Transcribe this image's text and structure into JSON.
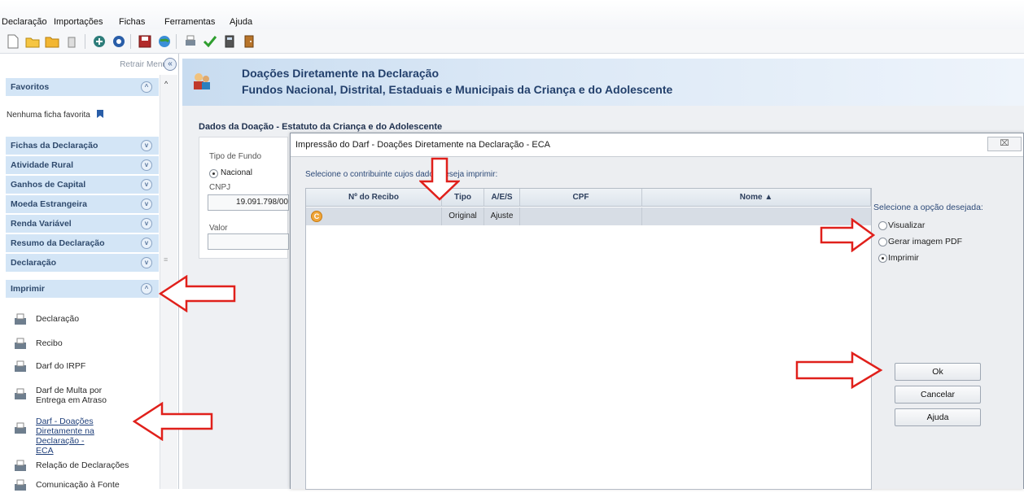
{
  "menu": {
    "items": [
      "Declaração",
      "Importações",
      "Fichas",
      "Ferramentas",
      "Ajuda"
    ]
  },
  "sidebar": {
    "retrair_label": "Retrair Menu",
    "favoritos_label": "Favoritos",
    "nenhuma_favorita": "Nenhuma ficha favorita",
    "sections": [
      "Fichas da Declaração",
      "Atividade Rural",
      "Ganhos de Capital",
      "Moeda Estrangeira",
      "Renda Variável",
      "Resumo da Declaração",
      "Declaração",
      "Imprimir"
    ],
    "print_items": [
      "Declaração",
      "Recibo",
      "Darf do IRPF",
      "Darf de Multa por Entrega em Atraso",
      "Darf - Doações Diretamente na Declaração - ECA",
      "Relação de Declarações",
      "Comunicação à Fonte"
    ]
  },
  "header": {
    "title1": "Doações Diretamente na Declaração",
    "title2": "Fundos Nacional, Distrital, Estaduais e Municipais da Criança e do Adolescente"
  },
  "form": {
    "section_title": "Dados da Doação - Estatuto da Criança e do Adolescente",
    "tipo_fundo_label": "Tipo de Fundo",
    "tipo_fundo_value": "Nacional",
    "cnpj_label": "CNPJ",
    "cnpj_value": "19.091.798/00",
    "valor_label": "Valor"
  },
  "dialog": {
    "title": "Impressão do Darf - Doações Diretamente na Declaração - ECA",
    "instruction": "Selecione o contribuinte cujos dados deseja imprimir:",
    "columns": [
      "Nº do Recibo",
      "Tipo",
      "A/E/S",
      "CPF",
      "Nome ▲"
    ],
    "rows": [
      {
        "icon": "C",
        "recibo": "",
        "tipo": "Original",
        "aes": "Ajuste",
        "cpf": "",
        "nome": ""
      }
    ],
    "options_title": "Selecione a opção desejada:",
    "options": [
      "Visualizar",
      "Gerar imagem PDF",
      "Imprimir"
    ],
    "selected_option": "Imprimir",
    "buttons": {
      "ok": "Ok",
      "cancelar": "Cancelar",
      "ajuda": "Ajuda"
    }
  },
  "colors": {
    "arrow": "#e0201b",
    "sidebar_header": "#d3e5f6",
    "header_text": "#23406c"
  }
}
